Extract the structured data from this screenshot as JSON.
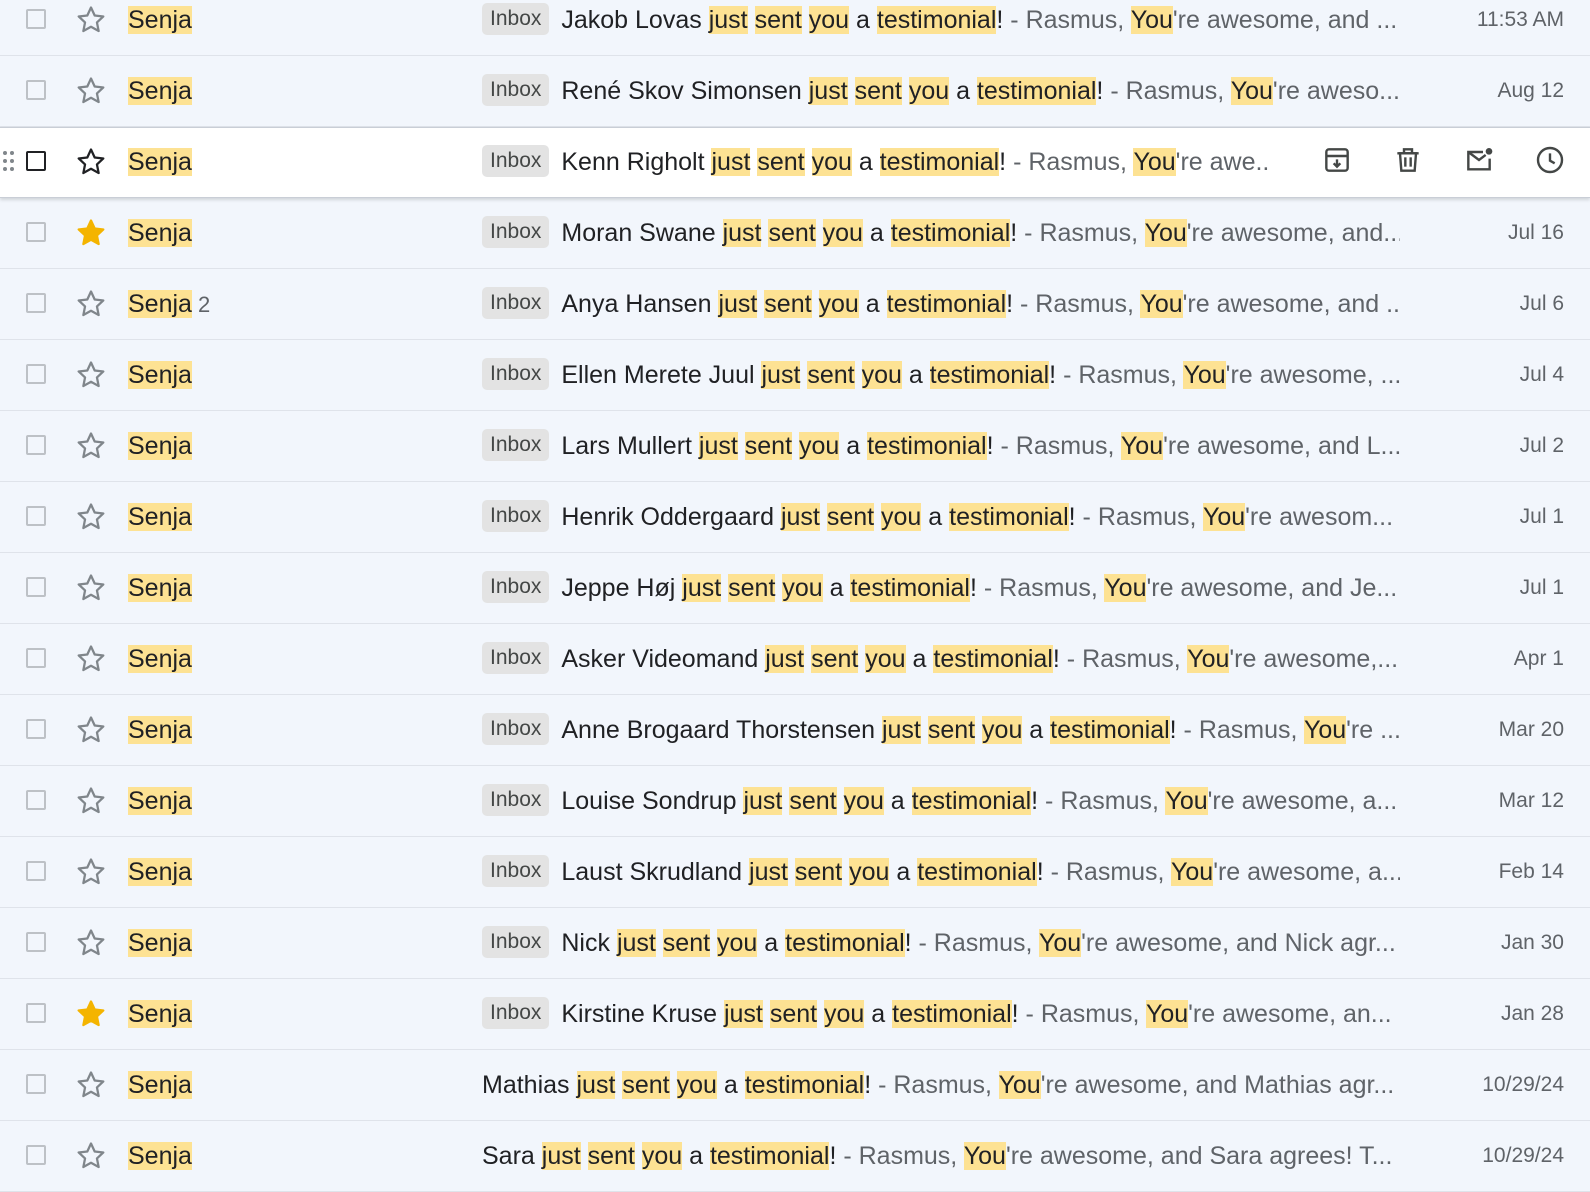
{
  "colors": {
    "background": "#f2f6fc",
    "highlight": "#fde293",
    "star_filled": "#f4b400",
    "badge_bg": "#e3e3e3",
    "text_primary": "#202124",
    "text_secondary": "#5f6368"
  },
  "hover_actions": [
    {
      "name": "archive-button",
      "icon": "archive-icon"
    },
    {
      "name": "delete-button",
      "icon": "trash-icon"
    },
    {
      "name": "mark-unread-button",
      "icon": "mark-unread-icon"
    },
    {
      "name": "snooze-button",
      "icon": "snooze-icon"
    }
  ],
  "emails": [
    {
      "sender": "Senja",
      "count": "",
      "starred": false,
      "label": "Inbox",
      "name": "Jakob Lovas",
      "snippet": "Rasmus, You're awesome, and ...",
      "date": "11:53 AM"
    },
    {
      "sender": "Senja",
      "count": "",
      "starred": false,
      "label": "Inbox",
      "name": "René Skov Simonsen",
      "snippet": "Rasmus, You're aweso...",
      "date": "Aug 12"
    },
    {
      "sender": "Senja",
      "count": "",
      "starred": false,
      "label": "Inbox",
      "name": "Kenn Righolt",
      "snippet": "Rasmus, You're awe...",
      "date": "",
      "hovered": true
    },
    {
      "sender": "Senja",
      "count": "",
      "starred": true,
      "label": "Inbox",
      "name": "Moran Swane",
      "snippet": "Rasmus, You're awesome, and...",
      "date": "Jul 16"
    },
    {
      "sender": "Senja",
      "count": "2",
      "starred": false,
      "label": "Inbox",
      "name": "Anya Hansen",
      "snippet": "Rasmus, You're awesome, and ...",
      "date": "Jul 6"
    },
    {
      "sender": "Senja",
      "count": "",
      "starred": false,
      "label": "Inbox",
      "name": "Ellen Merete Juul",
      "snippet": "Rasmus, You're awesome, ...",
      "date": "Jul 4"
    },
    {
      "sender": "Senja",
      "count": "",
      "starred": false,
      "label": "Inbox",
      "name": "Lars Mullert",
      "snippet": "Rasmus, You're awesome, and L...",
      "date": "Jul 2"
    },
    {
      "sender": "Senja",
      "count": "",
      "starred": false,
      "label": "Inbox",
      "name": "Henrik Oddergaard",
      "snippet": "Rasmus, You're awesom...",
      "date": "Jul 1"
    },
    {
      "sender": "Senja",
      "count": "",
      "starred": false,
      "label": "Inbox",
      "name": "Jeppe Høj",
      "snippet": "Rasmus, You're awesome, and Je...",
      "date": "Jul 1"
    },
    {
      "sender": "Senja",
      "count": "",
      "starred": false,
      "label": "Inbox",
      "name": "Asker Videomand",
      "snippet": "Rasmus, You're awesome,...",
      "date": "Apr 1"
    },
    {
      "sender": "Senja",
      "count": "",
      "starred": false,
      "label": "Inbox",
      "name": "Anne Brogaard Thorstensen",
      "snippet": "Rasmus, You're ...",
      "date": "Mar 20"
    },
    {
      "sender": "Senja",
      "count": "",
      "starred": false,
      "label": "Inbox",
      "name": "Louise Sondrup",
      "snippet": "Rasmus, You're awesome, a...",
      "date": "Mar 12"
    },
    {
      "sender": "Senja",
      "count": "",
      "starred": false,
      "label": "Inbox",
      "name": "Laust Skrudland",
      "snippet": "Rasmus, You're awesome, a...",
      "date": "Feb 14"
    },
    {
      "sender": "Senja",
      "count": "",
      "starred": false,
      "label": "Inbox",
      "name": "Nick",
      "snippet": "Rasmus, You're awesome, and Nick agr...",
      "date": "Jan 30"
    },
    {
      "sender": "Senja",
      "count": "",
      "starred": true,
      "label": "Inbox",
      "name": "Kirstine Kruse",
      "snippet": "Rasmus, You're awesome, an...",
      "date": "Jan 28"
    },
    {
      "sender": "Senja",
      "count": "",
      "starred": false,
      "label": "",
      "name": "Mathias",
      "snippet": "Rasmus, You're awesome, and Mathias agr...",
      "date": "10/29/24"
    },
    {
      "sender": "Senja",
      "count": "",
      "starred": false,
      "label": "",
      "name": "Sara",
      "snippet": "Rasmus, You're awesome, and Sara agrees! T...",
      "date": "10/29/24"
    }
  ]
}
